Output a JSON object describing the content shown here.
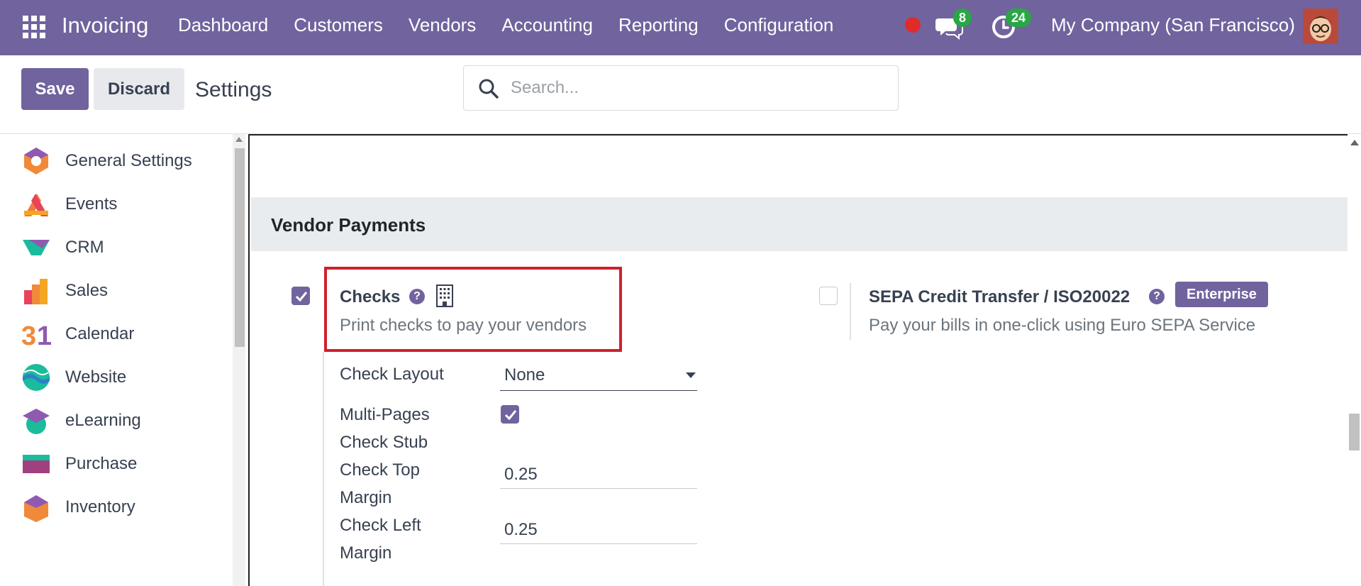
{
  "navbar": {
    "brand": "Invoicing",
    "menu": [
      "Dashboard",
      "Customers",
      "Vendors",
      "Accounting",
      "Reporting",
      "Configuration"
    ],
    "messages_count": "8",
    "activities_count": "24",
    "company": "My Company (San Francisco)"
  },
  "control": {
    "save_label": "Save",
    "discard_label": "Discard",
    "title": "Settings",
    "search_placeholder": "Search..."
  },
  "sidebar": {
    "items": [
      {
        "label": "General Settings",
        "icon": "general-settings-icon"
      },
      {
        "label": "Events",
        "icon": "events-icon"
      },
      {
        "label": "CRM",
        "icon": "crm-icon"
      },
      {
        "label": "Sales",
        "icon": "sales-icon"
      },
      {
        "label": "Calendar",
        "icon": "calendar-icon"
      },
      {
        "label": "Website",
        "icon": "website-icon"
      },
      {
        "label": "eLearning",
        "icon": "elearning-icon"
      },
      {
        "label": "Purchase",
        "icon": "purchase-icon"
      },
      {
        "label": "Inventory",
        "icon": "inventory-icon"
      }
    ]
  },
  "section": {
    "title": "Vendor Payments"
  },
  "checks": {
    "title": "Checks",
    "description": "Print checks to pay your vendors",
    "enabled": true,
    "fields": {
      "layout_label": "Check Layout",
      "layout_value": "None",
      "multipages_label_1": "Multi-Pages",
      "multipages_label_2": "Check Stub",
      "multipages_checked": true,
      "top_margin_label_1": "Check Top",
      "top_margin_label_2": "Margin",
      "top_margin_value": "0.25",
      "left_margin_label_1": "Check Left",
      "left_margin_label_2": "Margin",
      "left_margin_value": "0.25"
    }
  },
  "sepa": {
    "title": "SEPA Credit Transfer / ISO20022",
    "description": "Pay your bills in one-click using Euro SEPA Service",
    "badge": "Enterprise",
    "enabled": false
  },
  "colors": {
    "brand": "#71639e",
    "highlight": "#d0202c",
    "badge_green": "#28a745"
  }
}
